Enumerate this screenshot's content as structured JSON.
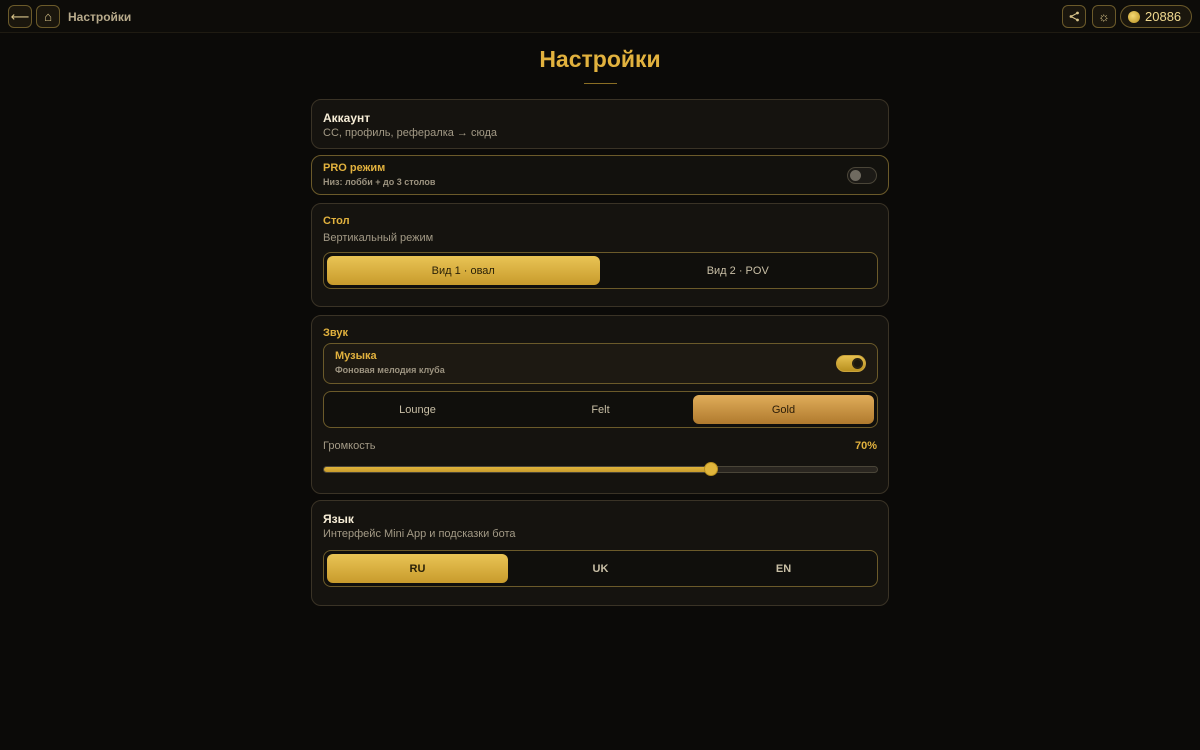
{
  "topbar": {
    "back_icon": "arrow-left-icon",
    "back_glyph": "⟵",
    "home_icon": "home-icon",
    "home_glyph": "⌂",
    "title": "Настройки",
    "share_icon": "share-icon",
    "share_glyph": "<",
    "theme_icon": "sun-icon",
    "theme_glyph": "☼",
    "coins_icon": "coin-icon",
    "coins": "20886"
  },
  "page": {
    "title": "Настройки"
  },
  "account": {
    "title": "Аккаунт",
    "subtitle": "CC, профиль, рефералка → сюда"
  },
  "pro": {
    "title": "PRO режим",
    "subtitle": "Низ: лобби + до 3 столов",
    "enabled": false
  },
  "table": {
    "title": "Стол",
    "subtitle": "Вертикальный режим",
    "options": [
      "Вид 1 · овал",
      "Вид 2 · POV"
    ],
    "selected": 0
  },
  "sound": {
    "title": "Звук",
    "music": {
      "title": "Музыка",
      "subtitle": "Фоновая мелодия клуба",
      "enabled": true
    },
    "themes": [
      "Lounge",
      "Felt",
      "Gold"
    ],
    "selected_theme": 2,
    "volume_label": "Громкость",
    "volume_value": "70%",
    "volume": 0.7
  },
  "language": {
    "title": "Язык",
    "subtitle": "Интерфейс Mini App и подсказки бота",
    "options": [
      "RU",
      "UK",
      "EN"
    ],
    "selected": 0
  },
  "colors": {
    "accent": "#e2b23e",
    "background": "#0b0a08"
  }
}
